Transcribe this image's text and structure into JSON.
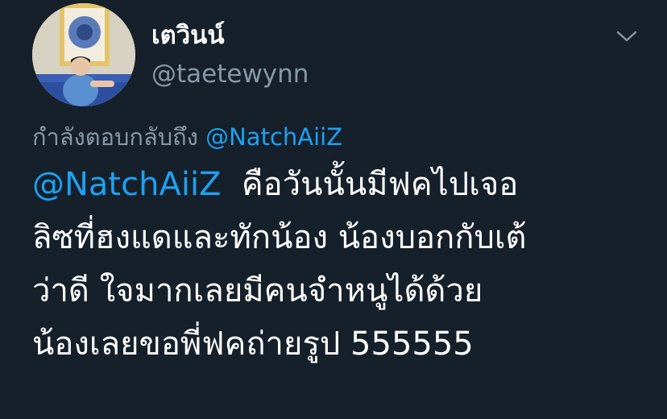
{
  "colors": {
    "background": "#15202b",
    "primary_text": "#ffffff",
    "secondary_text": "#8899a6",
    "accent": "#1da1f2"
  },
  "user": {
    "display_name": "เตวินน์",
    "handle": "@taetewynn",
    "avatar_icon": "profile-avatar"
  },
  "menu": {
    "caret_icon": "chevron-down-icon"
  },
  "reply": {
    "prefix": "กำลังตอบกลับถึง",
    "mention": "@NatchAiiZ"
  },
  "tweet": {
    "mention": "@NatchAiiZ",
    "line1_text": "คือวันนั้นมีฟคไปเจอ",
    "line2": "ลิซที่ฮงแดและทักน้อง น้องบอกกับเต้",
    "line3": "ว่าดี ใจมากเลยมีคนจำหนูได้ด้วย",
    "line4": "น้องเลยขอพี่ฟคถ่ายรูป 555555"
  }
}
